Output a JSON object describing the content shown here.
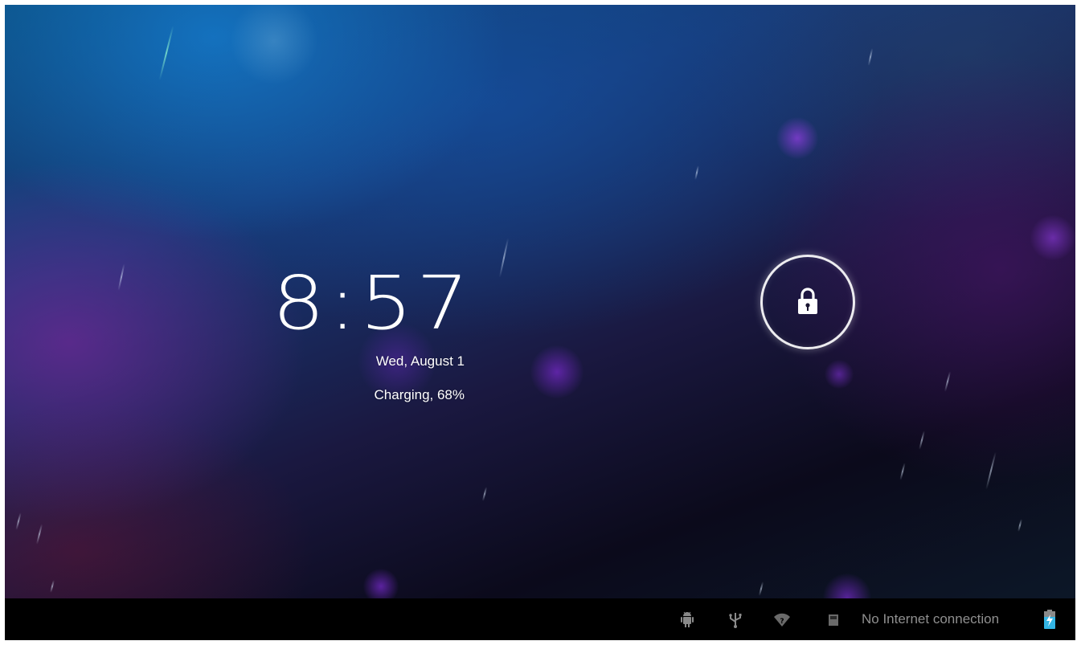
{
  "lockscreen": {
    "time": "8:57",
    "date": "Wed, August 1",
    "charging_status": "Charging, 68%",
    "unlock_icon": "lock-icon"
  },
  "status_bar": {
    "icons": [
      "android-debug-icon",
      "usb-icon",
      "wifi-no-signal-icon",
      "sd-card-icon"
    ],
    "network_status": "No Internet connection",
    "battery_icon": "battery-charging-icon"
  },
  "colors": {
    "status_bar_bg": "#000000",
    "status_text": "#8f8f8f",
    "battery_accent": "#33b5e5",
    "orb_purple": "#7a3cc0"
  }
}
